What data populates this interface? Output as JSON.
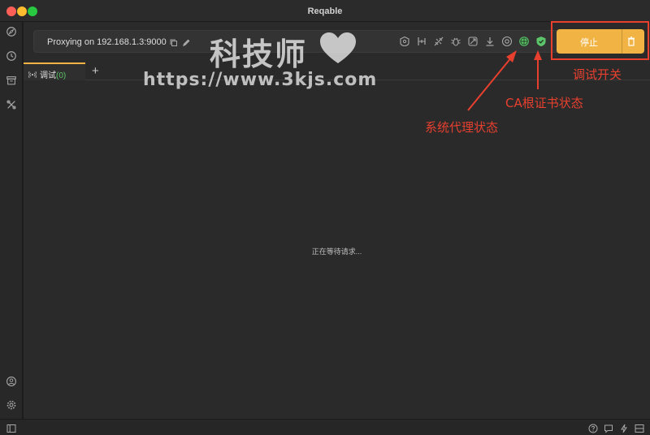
{
  "window": {
    "title": "Reqable"
  },
  "proxy": {
    "status_text": "Proxying on 192.168.1.3:9000"
  },
  "actions": {
    "stop_label": "停止"
  },
  "tabs": [
    {
      "label": "调试",
      "count": "(0)"
    }
  ],
  "add_tab_label": "+",
  "main": {
    "waiting_text": "正在等待请求..."
  },
  "watermark": {
    "title": "科技师",
    "url": "https://www.3kjs.com"
  },
  "annotations": {
    "debug_switch": "调试开关",
    "ca_status": "CA根证书状态",
    "system_proxy_status": "系统代理状态"
  },
  "colors": {
    "accent": "#f1b444",
    "status_green": "#5cc46a",
    "annotation_red": "#e8402f",
    "window_bg": "#2a2a2a"
  },
  "icons": {
    "sidebar_top": [
      "compass-icon",
      "history-icon",
      "archive-icon",
      "tools-icon"
    ],
    "sidebar_bottom": [
      "account-icon",
      "settings-icon"
    ],
    "toolbar": [
      "breakpoint-icon",
      "throttle-icon",
      "block-icon",
      "bug-icon",
      "rewrite-icon",
      "download-icon",
      "speed-icon",
      "system-proxy-icon",
      "ca-certificate-icon"
    ],
    "statusbar": [
      "toggle-sidebar-icon",
      "help-icon",
      "feedback-icon",
      "lightning-icon",
      "layout-icon"
    ]
  }
}
